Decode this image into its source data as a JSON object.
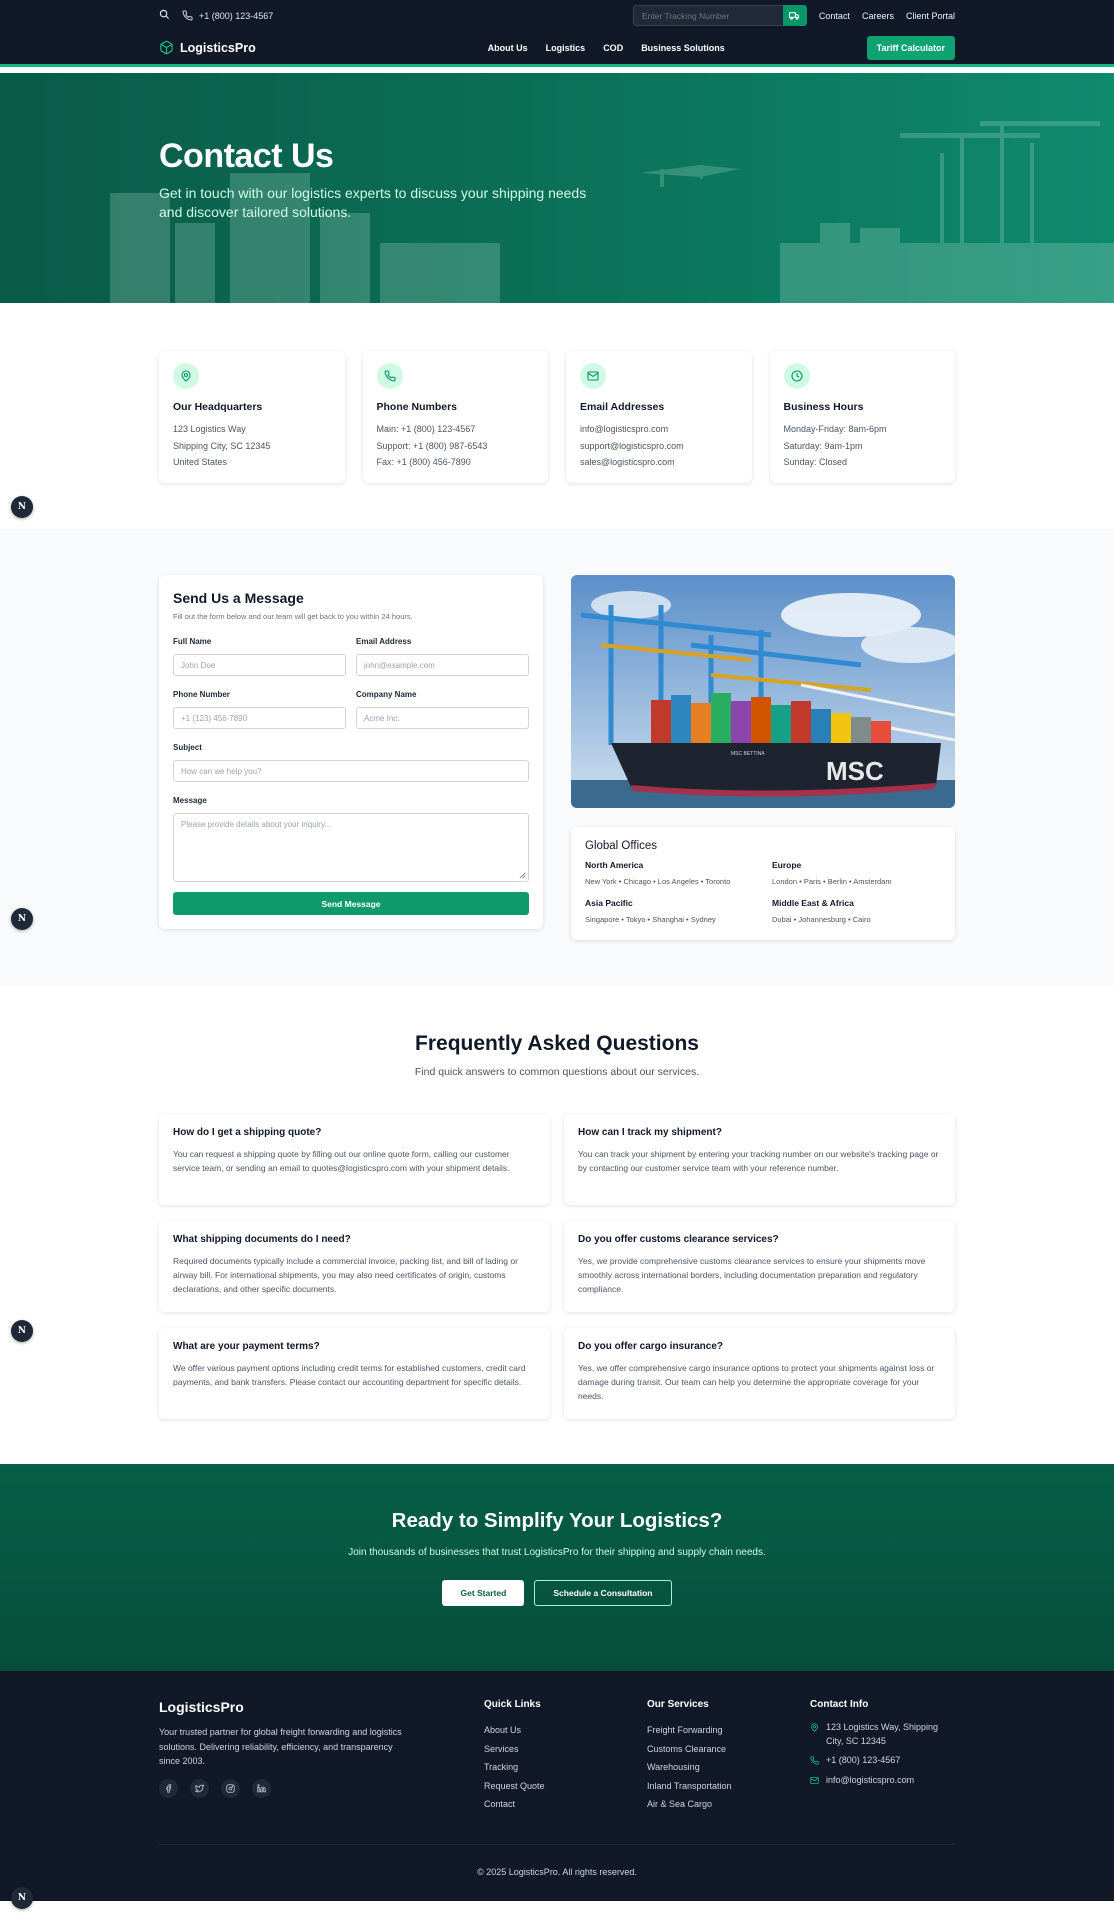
{
  "topbar": {
    "phone": "+1 (800) 123-4567",
    "tracking_placeholder": "Enter Tracking Number",
    "links": [
      "Contact",
      "Careers",
      "Client Portal"
    ]
  },
  "nav": {
    "brand": "LogisticsPro",
    "links": [
      "About Us",
      "Logistics",
      "COD",
      "Business Solutions"
    ],
    "cta": "Tariff Calculator"
  },
  "hero": {
    "title": "Contact Us",
    "subtitle": "Get in touch with our logistics experts to discuss your shipping needs and discover tailored solutions."
  },
  "info_cards": [
    {
      "icon": "map-pin-icon",
      "title": "Our Headquarters",
      "lines": [
        "123 Logistics Way",
        "Shipping City, SC 12345",
        "United States"
      ]
    },
    {
      "icon": "phone-icon",
      "title": "Phone Numbers",
      "lines": [
        "Main: +1 (800) 123-4567",
        "Support: +1 (800) 987-6543",
        "Fax: +1 (800) 456-7890"
      ]
    },
    {
      "icon": "mail-icon",
      "title": "Email Addresses",
      "lines": [
        "info@logisticspro.com",
        "support@logisticspro.com",
        "sales@logisticspro.com"
      ]
    },
    {
      "icon": "clock-icon",
      "title": "Business Hours",
      "lines": [
        "Monday-Friday: 8am-6pm",
        "Saturday: 9am-1pm",
        "Sunday: Closed"
      ]
    }
  ],
  "form": {
    "title": "Send Us a Message",
    "subtitle": "Fill out the form below and our team will get back to you within 24 hours.",
    "full_name_label": "Full Name",
    "full_name_placeholder": "John Doe",
    "email_label": "Email Address",
    "email_placeholder": "john@example.com",
    "phone_label": "Phone Number",
    "phone_placeholder": "+1 (123) 456-7890",
    "company_label": "Company Name",
    "company_placeholder": "Acme Inc.",
    "subject_label": "Subject",
    "subject_placeholder": "How can we help you?",
    "message_label": "Message",
    "message_placeholder": "Please provide details about your inquiry...",
    "submit": "Send Message"
  },
  "image": {
    "ship_name": "MSC",
    "ship_side_text": "MSC BETTINA"
  },
  "offices": {
    "title": "Global Offices",
    "regions": [
      {
        "name": "North America",
        "cities": "New York • Chicago • Los Angeles • Toronto"
      },
      {
        "name": "Europe",
        "cities": "London • Paris • Berlin • Amsterdam"
      },
      {
        "name": "Asia Pacific",
        "cities": "Singapore • Tokyo • Shanghai • Sydney"
      },
      {
        "name": "Middle East & Africa",
        "cities": "Dubai • Johannesburg • Cairo"
      }
    ]
  },
  "faq": {
    "title": "Frequently Asked Questions",
    "subtitle": "Find quick answers to common questions about our services.",
    "items": [
      {
        "q": "How do I get a shipping quote?",
        "a": "You can request a shipping quote by filling out our online quote form, calling our customer service team, or sending an email to quotes@logisticspro.com with your shipment details."
      },
      {
        "q": "How can I track my shipment?",
        "a": "You can track your shipment by entering your tracking number on our website's tracking page or by contacting our customer service team with your reference number."
      },
      {
        "q": "What shipping documents do I need?",
        "a": "Required documents typically include a commercial invoice, packing list, and bill of lading or airway bill. For international shipments, you may also need certificates of origin, customs declarations, and other specific documents."
      },
      {
        "q": "Do you offer customs clearance services?",
        "a": "Yes, we provide comprehensive customs clearance services to ensure your shipments move smoothly across international borders, including documentation preparation and regulatory compliance."
      },
      {
        "q": "What are your payment terms?",
        "a": "We offer various payment options including credit terms for established customers, credit card payments, and bank transfers. Please contact our accounting department for specific details."
      },
      {
        "q": "Do you offer cargo insurance?",
        "a": "Yes, we offer comprehensive cargo insurance options to protect your shipments against loss or damage during transit. Our team can help you determine the appropriate coverage for your needs."
      }
    ]
  },
  "cta": {
    "title": "Ready to Simplify Your Logistics?",
    "subtitle": "Join thousands of businesses that trust LogisticsPro for their shipping and supply chain needs.",
    "primary": "Get Started",
    "secondary": "Schedule a Consultation"
  },
  "footer": {
    "brand": "LogisticsPro",
    "description": "Your trusted partner for global freight forwarding and logistics solutions. Delivering reliability, efficiency, and transparency since 2003.",
    "quick_links_title": "Quick Links",
    "quick_links": [
      "About Us",
      "Services",
      "Tracking",
      "Request Quote",
      "Contact"
    ],
    "services_title": "Our Services",
    "services": [
      "Freight Forwarding",
      "Customs Clearance",
      "Warehousing",
      "Inland Transportation",
      "Air & Sea Cargo"
    ],
    "contact_title": "Contact Info",
    "contact_address": "123 Logistics Way, Shipping City, SC 12345",
    "contact_phone": "+1 (800) 123-4567",
    "contact_email": "info@logisticspro.com",
    "copyright": "© 2025 LogisticsPro. All rights reserved."
  },
  "badge_letter": "N",
  "colors": {
    "primary": "#10b981",
    "dark": "#111827",
    "cta_bg": "#065f46"
  }
}
